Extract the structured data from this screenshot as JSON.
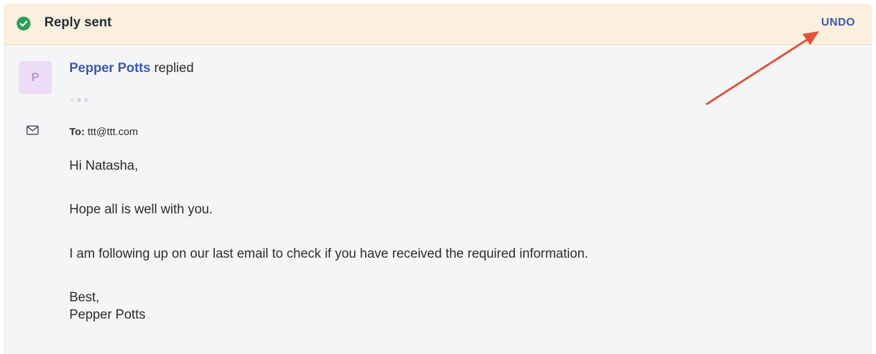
{
  "banner": {
    "title": "Reply sent",
    "undo_label": "UNDO",
    "icon": "check-circle-icon",
    "accent_color": "#2f9e5b",
    "background_color": "#fcefdd",
    "link_color": "#3c57b8"
  },
  "message": {
    "avatar_initial": "P",
    "sender_name": "Pepper Potts",
    "action_text": "replied",
    "to_label": "To:",
    "to_address": "ttt@ttt.com",
    "body": {
      "greeting": "Hi Natasha,",
      "line1": "Hope all is well with you.",
      "line2": "I am following up on our last email to check if you have received the required information.",
      "signoff": "Best,",
      "signature": "Pepper Potts"
    }
  },
  "annotation": {
    "icon": "red-arrow",
    "color": "#e0523a"
  }
}
